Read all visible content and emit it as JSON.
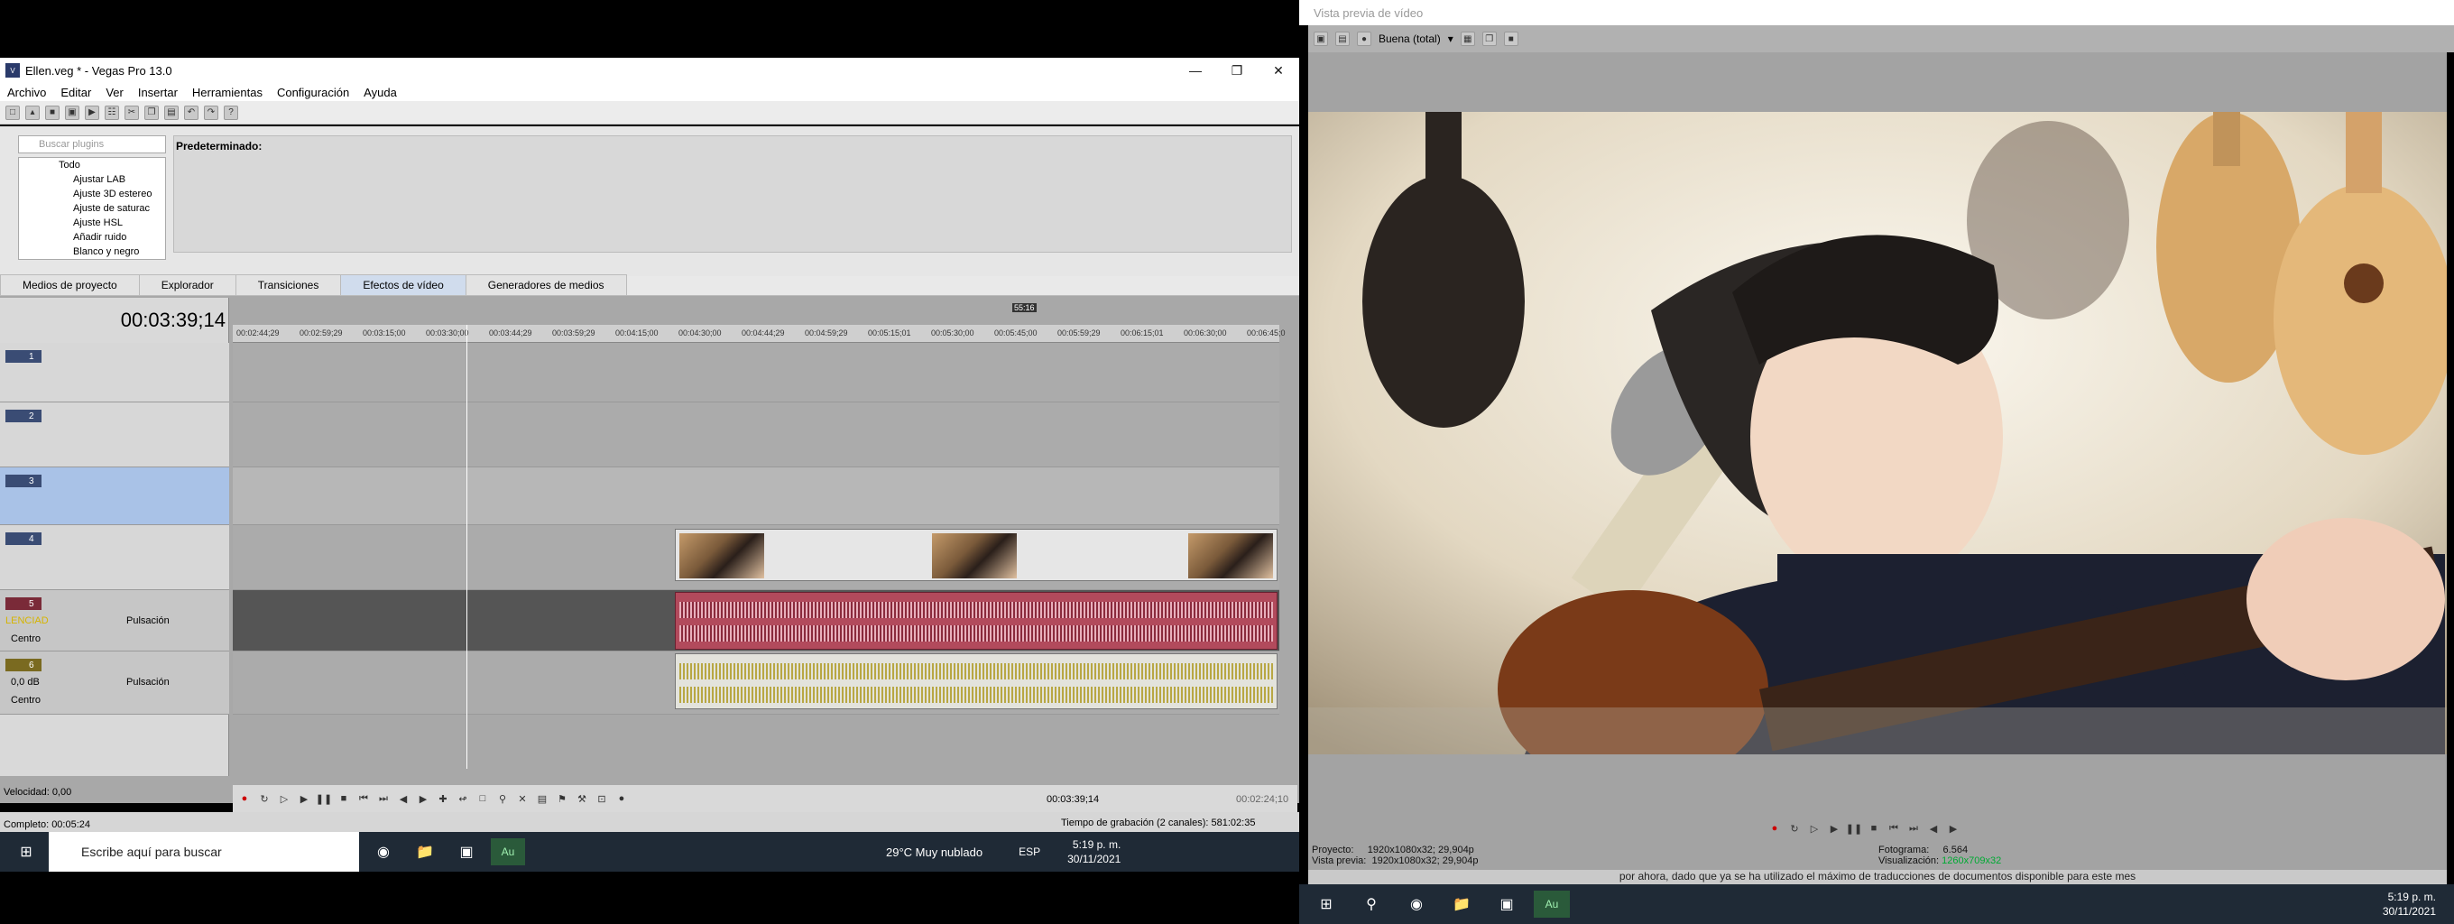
{
  "main_window": {
    "title": "Ellen.veg * - Vegas Pro 13.0",
    "menu": [
      "Archivo",
      "Editar",
      "Ver",
      "Insertar",
      "Herramientas",
      "Configuración",
      "Ayuda"
    ]
  },
  "fx_panel": {
    "search_placeholder": "Buscar plugins",
    "tree_root": "Todo",
    "tree_items": [
      "Ajustar LAB",
      "Ajuste 3D estereo",
      "Ajuste de saturac",
      "Ajuste HSL",
      "Añadir ruido",
      "Blanco y negro"
    ],
    "preset_label": "Predeterminado:"
  },
  "tabs": [
    "Medios de proyecto",
    "Explorador",
    "Transiciones",
    "Efectos de vídeo",
    "Generadores de medios"
  ],
  "active_tab": "Efectos de vídeo",
  "timeline": {
    "timecode": "00:03:39;14",
    "ruler_marker": "55:16",
    "ruler": [
      "00:02:44;29",
      "00:02:59;29",
      "00:03:15;00",
      "00:03:30;00",
      "00:03:44;29",
      "00:03:59;29",
      "00:04:15;00",
      "00:04:30;00",
      "00:04:44;29",
      "00:04:59;29",
      "00:05:15;01",
      "00:05:30;00",
      "00:05:45;00",
      "00:05:59;29",
      "00:06:15;01",
      "00:06:30;00",
      "00:06:45;0"
    ],
    "tracks": [
      {
        "num": "1",
        "type": "video"
      },
      {
        "num": "2",
        "type": "video"
      },
      {
        "num": "3",
        "type": "video",
        "selected": true
      },
      {
        "num": "4",
        "type": "video"
      },
      {
        "num": "5",
        "type": "audio",
        "volume": "LENCIAD",
        "pan": "Pulsación",
        "center": "Centro"
      },
      {
        "num": "6",
        "type": "audio",
        "volume": "0,0 dB",
        "pan": "Pulsación",
        "center": "Centro"
      }
    ]
  },
  "transport": {
    "speed": "Velocidad: 0,00",
    "timecode_small": "00:03:39;14",
    "end_time": "00:02:24;10"
  },
  "status": {
    "complete": "Completo: 00:05:24",
    "record_time": "Tiempo de grabación (2 canales): 581:02:35"
  },
  "taskbar": {
    "search_placeholder": "Escribe aquí para buscar",
    "weather": "29°C  Muy nublado",
    "lang": "ESP",
    "time": "5:19 p. m.",
    "date": "30/11/2021"
  },
  "preview": {
    "title": "Vista previa de vídeo",
    "quality": "Buena (total)",
    "project_label": "Proyecto:",
    "project_value": "1920x1080x32; 29,904p",
    "preview_label": "Vista previa:",
    "preview_value": "1920x1080x32; 29,904p",
    "frame_label": "Fotograma:",
    "frame_value": "6.564",
    "display_label": "Visualización:",
    "display_value": "1260x709x32",
    "bottom_notice": "por ahora, dado que ya se ha utilizado el máximo de traducciones de documentos disponible para este mes"
  },
  "right_taskbar": {
    "time": "5:19 p. m.",
    "date": "30/11/2021"
  },
  "colors": {
    "taskbar": "#1f2a36",
    "audio_red": "#b24a5c",
    "audio_yellow": "#b8a743",
    "selection": "#a9c2e7"
  }
}
